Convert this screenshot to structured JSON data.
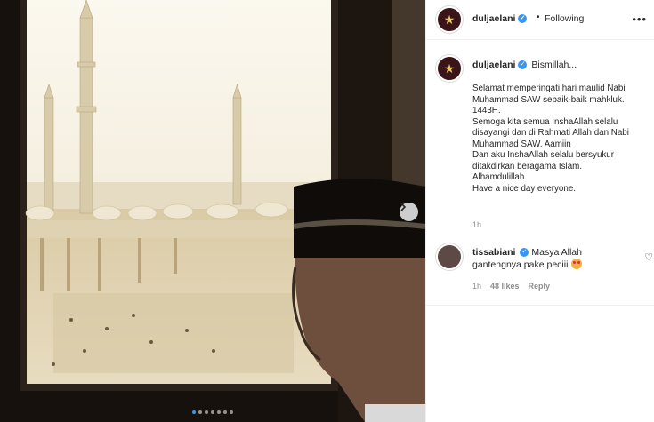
{
  "post": {
    "author": "duljaelani",
    "follow_separator": "•",
    "follow_status": "Following",
    "more_icon": "more-horizontal-icon",
    "caption_first_line": "Bismillah...",
    "caption_body": "Selamat memperingati hari maulid Nabi Muhammad SAW sebaik-baik mahkluk.\n1443H.\nSemoga kita semua InshaAllah selalu disayangi dan di Rahmati Allah dan Nabi Muhammad SAW. Aamiin\nDan aku InshaAllah selalu bersyukur ditakdirkan beragama Islam.\nAlhamdulillah.\nHave a nice day everyone.",
    "caption_time": "1h",
    "carousel_total": 7,
    "carousel_current": 1
  },
  "comment": {
    "author": "tissabiani",
    "text": "Masya Allah gantengnya pake peciiii",
    "time": "1h",
    "likes": "48 likes",
    "reply": "Reply"
  },
  "colors": {
    "verified": "#3897f0",
    "meta": "#8e8e8e",
    "border": "#efefef"
  }
}
